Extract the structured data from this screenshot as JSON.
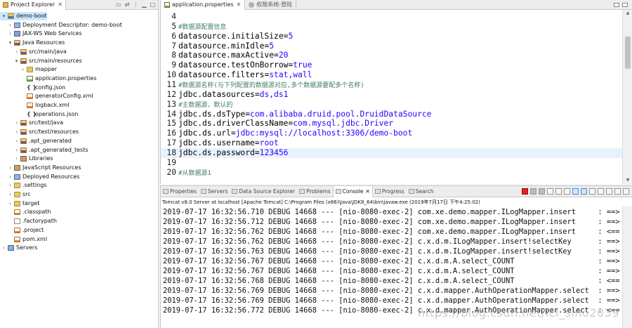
{
  "explorer": {
    "tab_label": "Project Explorer",
    "close": "✕",
    "tree": [
      {
        "label": "demo-boot",
        "icon": "project",
        "indent": 0,
        "twisty": "▾",
        "selected": true
      },
      {
        "label": "Deployment Descriptor: demo-boot",
        "icon": "dep",
        "indent": 1,
        "twisty": "›"
      },
      {
        "label": "JAX-WS Web Services",
        "icon": "ws",
        "indent": 1,
        "twisty": "›"
      },
      {
        "label": "Java Resources",
        "icon": "src",
        "indent": 1,
        "twisty": "▾"
      },
      {
        "label": "src/main/java",
        "icon": "src",
        "indent": 2,
        "twisty": "›"
      },
      {
        "label": "src/main/resources",
        "icon": "src",
        "indent": 2,
        "twisty": "▾"
      },
      {
        "label": "mapper",
        "icon": "folder",
        "indent": 3,
        "twisty": "›"
      },
      {
        "label": "application.properties",
        "icon": "prop",
        "indent": 3,
        "twisty": ""
      },
      {
        "label": "config.json",
        "icon": "json",
        "indent": 3,
        "twisty": ""
      },
      {
        "label": "generatorConfig.xml",
        "icon": "xml",
        "indent": 3,
        "twisty": ""
      },
      {
        "label": "logback.xml",
        "icon": "xml",
        "indent": 3,
        "twisty": ""
      },
      {
        "label": "operations.json",
        "icon": "json",
        "indent": 3,
        "twisty": ""
      },
      {
        "label": "src/test/java",
        "icon": "src",
        "indent": 2,
        "twisty": "›"
      },
      {
        "label": "src/test/resources",
        "icon": "src",
        "indent": 2,
        "twisty": "›"
      },
      {
        "label": ".apt_generated",
        "icon": "src",
        "indent": 2,
        "twisty": "›"
      },
      {
        "label": ".apt_generated_tests",
        "icon": "src",
        "indent": 2,
        "twisty": "›"
      },
      {
        "label": "Libraries",
        "icon": "lib",
        "indent": 2,
        "twisty": "›"
      },
      {
        "label": "JavaScript Resources",
        "icon": "lib",
        "indent": 1,
        "twisty": "›"
      },
      {
        "label": "Deployed Resources",
        "icon": "dep",
        "indent": 1,
        "twisty": "›"
      },
      {
        "label": ".settings",
        "icon": "folder",
        "indent": 1,
        "twisty": "›"
      },
      {
        "label": "src",
        "icon": "folder",
        "indent": 1,
        "twisty": "›"
      },
      {
        "label": "target",
        "icon": "folder",
        "indent": 1,
        "twisty": "›"
      },
      {
        "label": ".classpath",
        "icon": "xml",
        "indent": 1,
        "twisty": ""
      },
      {
        "label": ".factorypath",
        "icon": "file",
        "indent": 1,
        "twisty": ""
      },
      {
        "label": ".project",
        "icon": "xml",
        "indent": 1,
        "twisty": ""
      },
      {
        "label": "pom.xml",
        "icon": "xml",
        "indent": 1,
        "twisty": ""
      },
      {
        "label": "Servers",
        "icon": "server",
        "indent": 0,
        "twisty": "›"
      }
    ]
  },
  "editor": {
    "tabs": [
      {
        "label": "application.properties",
        "active": true
      },
      {
        "label": "权限系统-登陆",
        "active": false
      }
    ],
    "close": "✕",
    "current_line": 18,
    "lines": [
      {
        "no": "4",
        "key": "",
        "eq": "",
        "val": "",
        "comment": ""
      },
      {
        "no": "5",
        "key": "",
        "eq": "",
        "val": "",
        "comment": "#数据源配置信息"
      },
      {
        "no": "6",
        "key": "datasource.initialSize",
        "eq": "=",
        "val": "5",
        "comment": ""
      },
      {
        "no": "7",
        "key": "datasource.minIdle",
        "eq": "=",
        "val": "5",
        "comment": ""
      },
      {
        "no": "8",
        "key": "datasource.maxActive",
        "eq": "=",
        "val": "20",
        "comment": ""
      },
      {
        "no": "9",
        "key": "datasource.testOnBorrow",
        "eq": "=",
        "val": "true",
        "comment": ""
      },
      {
        "no": "10",
        "key": "datasource.filters",
        "eq": "=",
        "val": "stat,wall",
        "comment": ""
      },
      {
        "no": "11",
        "key": "",
        "eq": "",
        "val": "",
        "comment": "#数据源名称(与下列配置的数据源对应,多个数据源要配多个名称)"
      },
      {
        "no": "12",
        "key": "jdbc.datasources",
        "eq": "=",
        "val": "ds,ds1",
        "comment": ""
      },
      {
        "no": "13",
        "key": "",
        "eq": "",
        "val": "",
        "comment": "#主数据源，默认的"
      },
      {
        "no": "14",
        "key": "jdbc.ds.dsType",
        "eq": "=",
        "val": "com.alibaba.druid.pool.DruidDataSource",
        "comment": ""
      },
      {
        "no": "15",
        "key": "jdbc.ds.driverClassName",
        "eq": "=",
        "val": "com.mysql.jdbc.Driver",
        "comment": ""
      },
      {
        "no": "16",
        "key": "jdbc.ds.url",
        "eq": "=",
        "val": "jdbc:mysql://localhost:3306/demo-boot",
        "comment": ""
      },
      {
        "no": "17",
        "key": "jdbc.ds.username",
        "eq": "=",
        "val": "root",
        "comment": ""
      },
      {
        "no": "18",
        "key": "jdbc.ds.password",
        "eq": "=",
        "val": "123456",
        "comment": ""
      },
      {
        "no": "19",
        "key": "",
        "eq": "",
        "val": "",
        "comment": ""
      },
      {
        "no": "20",
        "key": "",
        "eq": "",
        "val": "",
        "comment": "#从数据源1"
      }
    ]
  },
  "console": {
    "tabs": [
      {
        "label": "Properties",
        "active": false
      },
      {
        "label": "Servers",
        "active": false
      },
      {
        "label": "Data Source Explorer",
        "active": false
      },
      {
        "label": "Problems",
        "active": false
      },
      {
        "label": "Console",
        "active": true
      },
      {
        "label": "Progress",
        "active": false
      },
      {
        "label": "Search",
        "active": false
      }
    ],
    "close": "✕",
    "header": "Tomcat v8.0 Server at localhost [Apache Tomcat] C:\\Program Files (x86)\\Java\\JDK8_64\\bin\\javaw.exe (2019年7月17日 下午4:25:02)",
    "lines": [
      "2019-07-17 16:32:56.710 DEBUG 14668 --- [nio-8080-exec-2] com.xe.demo.mapper.ILogMapper.insert     : ==>",
      "2019-07-17 16:32:56.712 DEBUG 14668 --- [nio-8080-exec-2] com.xe.demo.mapper.ILogMapper.insert     : ==>",
      "2019-07-17 16:32:56.762 DEBUG 14668 --- [nio-8080-exec-2] com.xe.demo.mapper.ILogMapper.insert     : <==",
      "2019-07-17 16:32:56.762 DEBUG 14668 --- [nio-8080-exec-2] c.x.d.m.ILogMapper.insert!selectKey      : ==>",
      "2019-07-17 16:32:56.763 DEBUG 14668 --- [nio-8080-exec-2] c.x.d.m.ILogMapper.insert!selectKey      : ==>",
      "2019-07-17 16:32:56.767 DEBUG 14668 --- [nio-8080-exec-2] c.x.d.m.A.select_COUNT                   : ==>",
      "2019-07-17 16:32:56.767 DEBUG 14668 --- [nio-8080-exec-2] c.x.d.m.A.select_COUNT                   : ==>",
      "2019-07-17 16:32:56.768 DEBUG 14668 --- [nio-8080-exec-2] c.x.d.m.A.select_COUNT                   : <==",
      "2019-07-17 16:32:56.769 DEBUG 14668 --- [nio-8080-exec-2] c.x.d.mapper.AuthOperationMapper.select  : ==>",
      "2019-07-17 16:32:56.769 DEBUG 14668 --- [nio-8080-exec-2] c.x.d.mapper.AuthOperationMapper.select  : ==>",
      "2019-07-17 16:32:56.772 DEBUG 14668 --- [nio-8080-exec-2] c.x.d.mapper.AuthOperationMapper.select  : <=="
    ],
    "watermark": "https://blog.csdn.net/lcl_sino2039"
  }
}
